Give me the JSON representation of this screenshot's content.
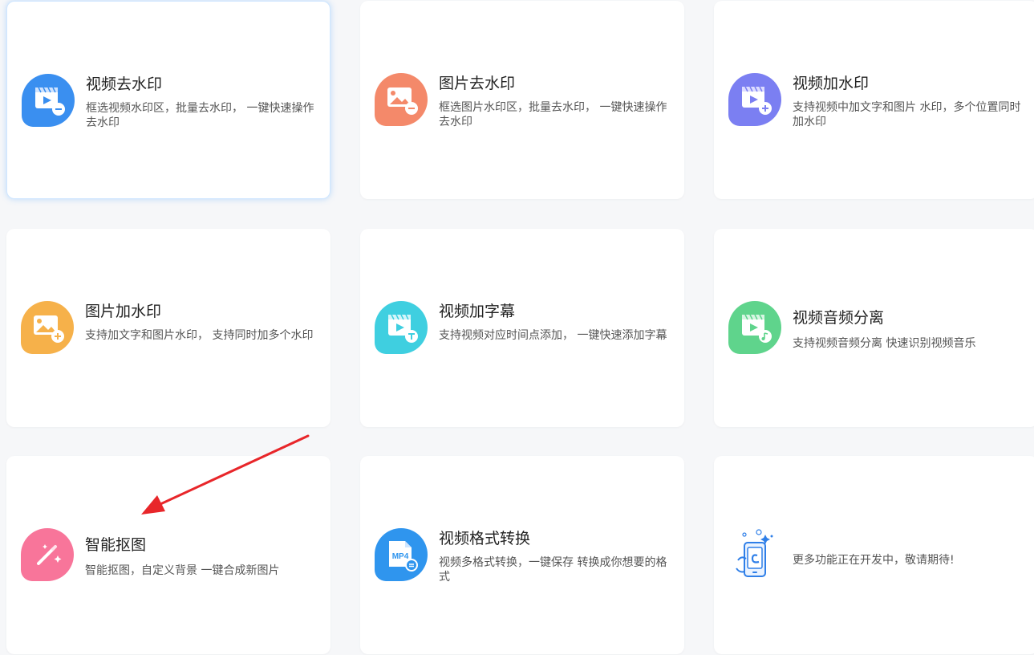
{
  "cards": [
    {
      "title": "视频去水印",
      "desc": "框选视频水印区，批量去水印， 一键快速操作去水印",
      "icon": "video-remove-watermark-icon",
      "color": "#3a8ff0"
    },
    {
      "title": "图片去水印",
      "desc": "框选图片水印区，批量去水印， 一键快速操作去水印",
      "icon": "image-remove-watermark-icon",
      "color": "#f4896a"
    },
    {
      "title": "视频加水印",
      "desc": "支持视频中加文字和图片 水印，多个位置同时加水印",
      "icon": "video-add-watermark-icon",
      "color": "#7b7ff2"
    },
    {
      "title": "图片加水印",
      "desc": "支持加文字和图片水印， 支持同时加多个水印",
      "icon": "image-add-watermark-icon",
      "color": "#f6b14a"
    },
    {
      "title": "视频加字幕",
      "desc": "支持视频对应时间点添加， 一键快速添加字幕",
      "icon": "video-add-subtitle-icon",
      "color": "#3fcfe0"
    },
    {
      "title": "视频音频分离",
      "desc": "支持视频音频分离 快速识别视频音乐",
      "icon": "video-audio-separate-icon",
      "color": "#5fd48c"
    },
    {
      "title": "智能抠图",
      "desc": "智能抠图，自定义背景 一键合成新图片",
      "icon": "magic-wand-icon",
      "color": "#f8759a"
    },
    {
      "title": "视频格式转换",
      "desc": "视频多格式转换，一键保存 转换成你想要的格式",
      "icon": "mp4-convert-icon",
      "color": "#2f95ee",
      "badge": "MP4"
    },
    {
      "title": "",
      "desc": "更多功能正在开发中，敬请期待!",
      "icon": "developing-phone-icon",
      "color": "#2f7fe8"
    }
  ]
}
